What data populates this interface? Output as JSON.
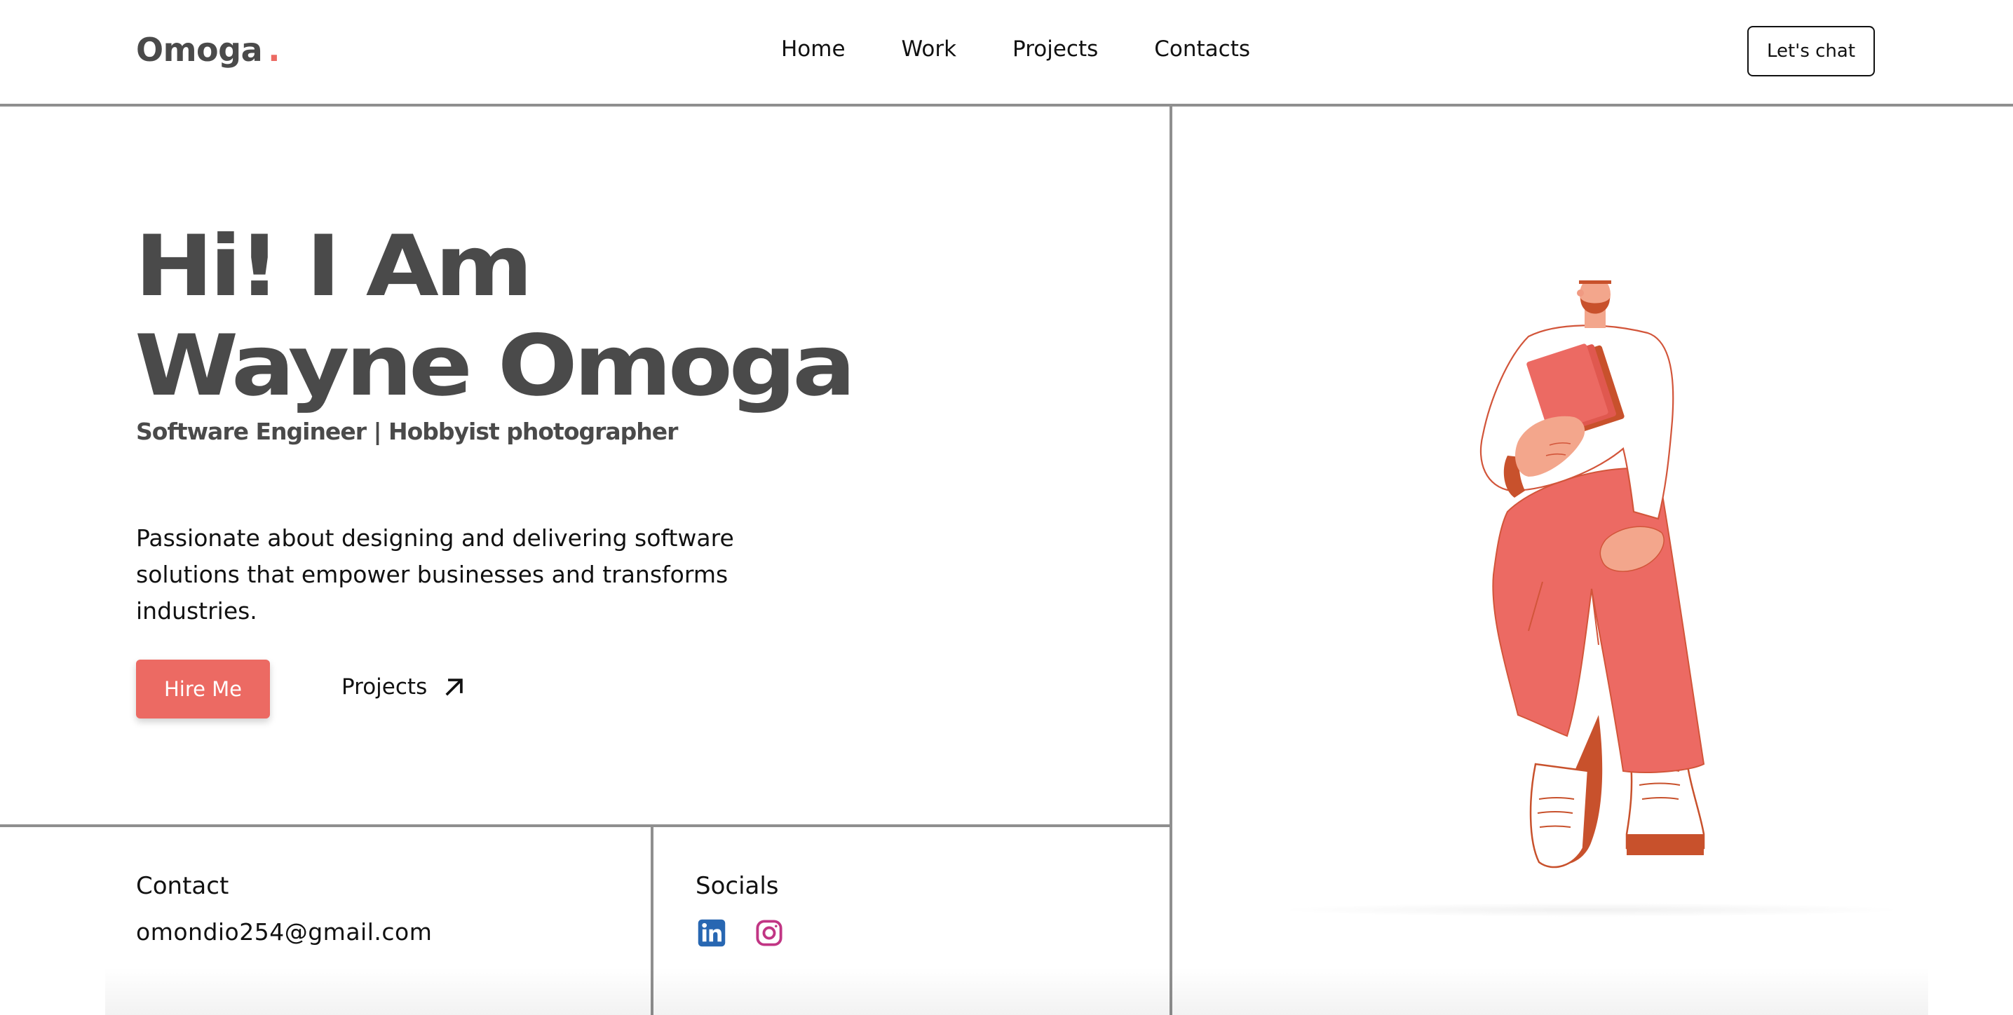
{
  "header": {
    "logo_text": "Omoga",
    "logo_dot": ".",
    "nav": [
      "Home",
      "Work",
      "Projects",
      "Contacts"
    ],
    "cta_label": "Let's chat"
  },
  "hero": {
    "title_line1": "Hi! I Am",
    "title_line2": "Wayne Omoga",
    "subtitle": "Software Engineer | Hobbyist photographer",
    "description_line1": "Passionate about designing and delivering software",
    "description_line2": "solutions that empower businesses and transforms industries.",
    "hire_label": "Hire Me",
    "projects_label": "Projects"
  },
  "contact": {
    "title": "Contact",
    "email": "omondio254@gmail.com"
  },
  "socials": {
    "title": "Socials",
    "icons": [
      "linkedin-icon",
      "instagram-icon"
    ]
  },
  "colors": {
    "accent": "#ec6a63",
    "text_dark": "#4a4a4a",
    "border": "#8f8f8f",
    "linkedin": "#2867b2",
    "instagram": "#c13584"
  }
}
